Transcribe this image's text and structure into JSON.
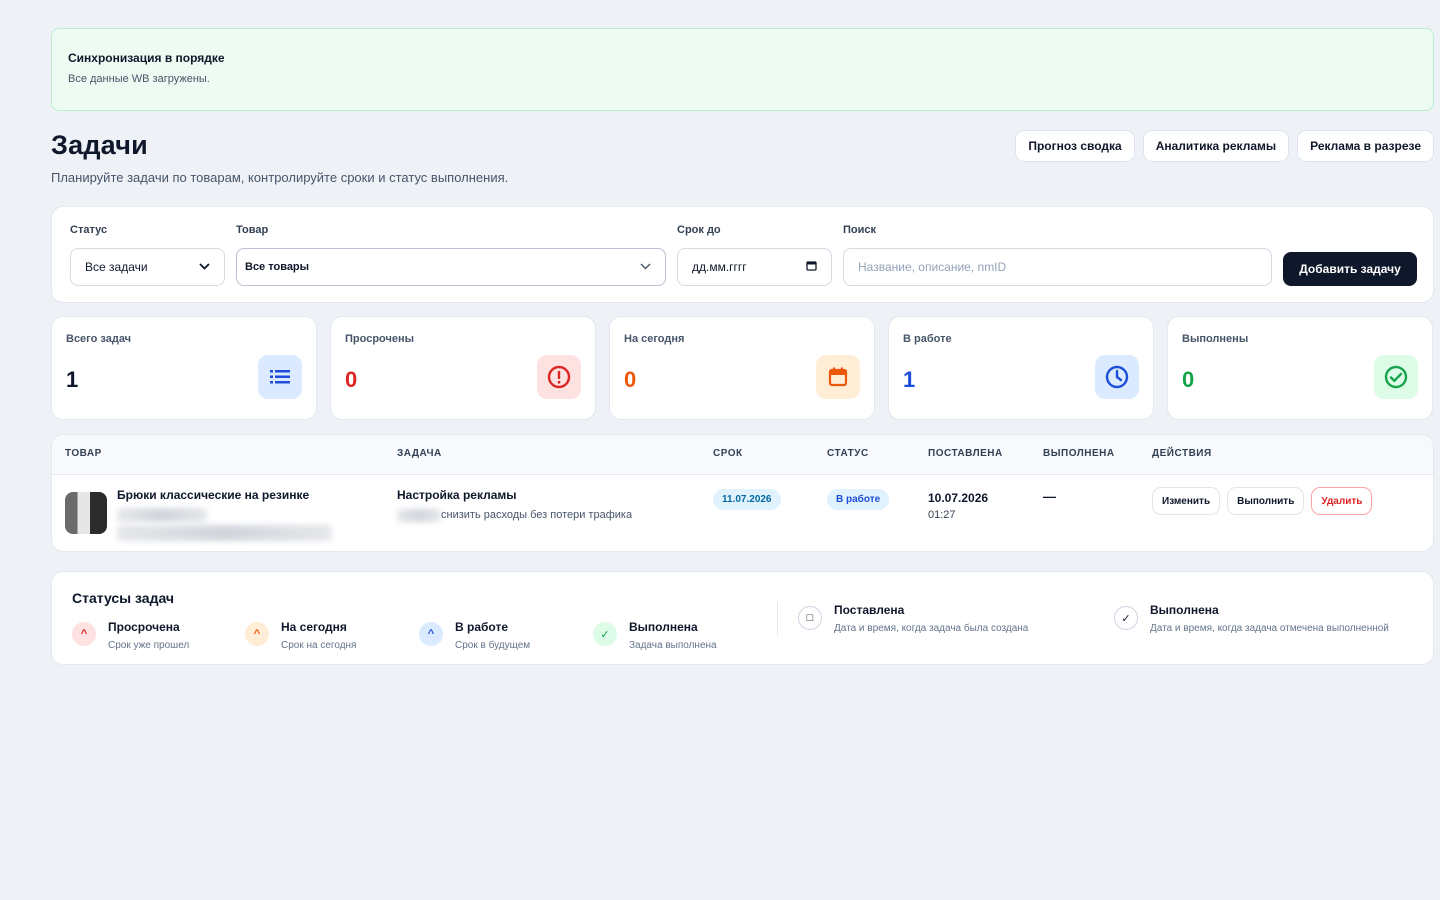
{
  "sync": {
    "title": "Синхронизация в порядке",
    "subtitle": "Все данные WB загружены."
  },
  "page": {
    "title": "Задачи",
    "subtitle": "Планируйте задачи по товарам, контролируйте сроки и статус выполнения."
  },
  "top_buttons": [
    "Прогноз сводка",
    "Аналитика рекламы",
    "Реклама в разрезе"
  ],
  "filters": {
    "status_label": "Статус",
    "status_value": "Все задачи",
    "product_label": "Товар",
    "product_value": "Все товары",
    "date_label": "Срок до",
    "date_value": "дд.мм.гггг",
    "search_label": "Поиск",
    "search_placeholder": "Название, описание, nmID",
    "add_button": "Добавить задачу"
  },
  "stats": [
    {
      "label": "Всего задач",
      "value": "1",
      "color": "#0f172a",
      "icon": "list-icon",
      "bg": "#dbeafe",
      "fg": "#1d4ed8"
    },
    {
      "label": "Просрочены",
      "value": "0",
      "color": "#dc2626",
      "icon": "alert-circle-icon",
      "bg": "#fee2e2",
      "fg": "#dc2626"
    },
    {
      "label": "На сегодня",
      "value": "0",
      "color": "#ea580c",
      "icon": "calendar-icon",
      "bg": "#ffedd5",
      "fg": "#ea580c"
    },
    {
      "label": "В работе",
      "value": "1",
      "color": "#1d4ed8",
      "icon": "clock-icon",
      "bg": "#dbeafe",
      "fg": "#1d4ed8"
    },
    {
      "label": "Выполнены",
      "value": "0",
      "color": "#16a34a",
      "icon": "check-circle-icon",
      "bg": "#dcfce7",
      "fg": "#16a34a"
    }
  ],
  "table": {
    "headers": [
      "ТОВАР",
      "ЗАДАЧА",
      "СРОК",
      "СТАТУС",
      "ПОСТАВЛЕНА",
      "ВЫПОЛНЕНА",
      "ДЕЙСТВИЯ"
    ],
    "rows": [
      {
        "product": "Брюки классические на резинке",
        "task_title": "Настройка рекламы",
        "task_desc": "снизить расходы без потери трафика",
        "deadline": "11.07.2026",
        "status": "В работе",
        "created_date": "10.07.2026",
        "created_time": "01:27",
        "completed": "—",
        "actions": {
          "edit": "Изменить",
          "complete": "Выполнить",
          "delete": "Удалить"
        }
      }
    ]
  },
  "legend": {
    "title": "Статусы задач",
    "items": [
      {
        "name": "Просрочена",
        "desc": "Срок уже прошел",
        "glyph": "^",
        "bg": "#fee2e2",
        "fg": "#dc2626"
      },
      {
        "name": "На сегодня",
        "desc": "Срок на сегодня",
        "glyph": "^",
        "bg": "#ffedd5",
        "fg": "#ea580c"
      },
      {
        "name": "В работе",
        "desc": "Срок в будущем",
        "glyph": "^",
        "bg": "#dbeafe",
        "fg": "#1d4ed8"
      },
      {
        "name": "Выполнена",
        "desc": "Задача выполнена",
        "glyph": "✓",
        "bg": "#dcfce7",
        "fg": "#16a34a"
      }
    ],
    "extra": [
      {
        "name": "Поставлена",
        "desc": "Дата и время, когда задача была создана",
        "glyph": "□"
      },
      {
        "name": "Выполнена",
        "desc": "Дата и время, когда задача отмечена выполненной",
        "glyph": "✓"
      }
    ]
  }
}
